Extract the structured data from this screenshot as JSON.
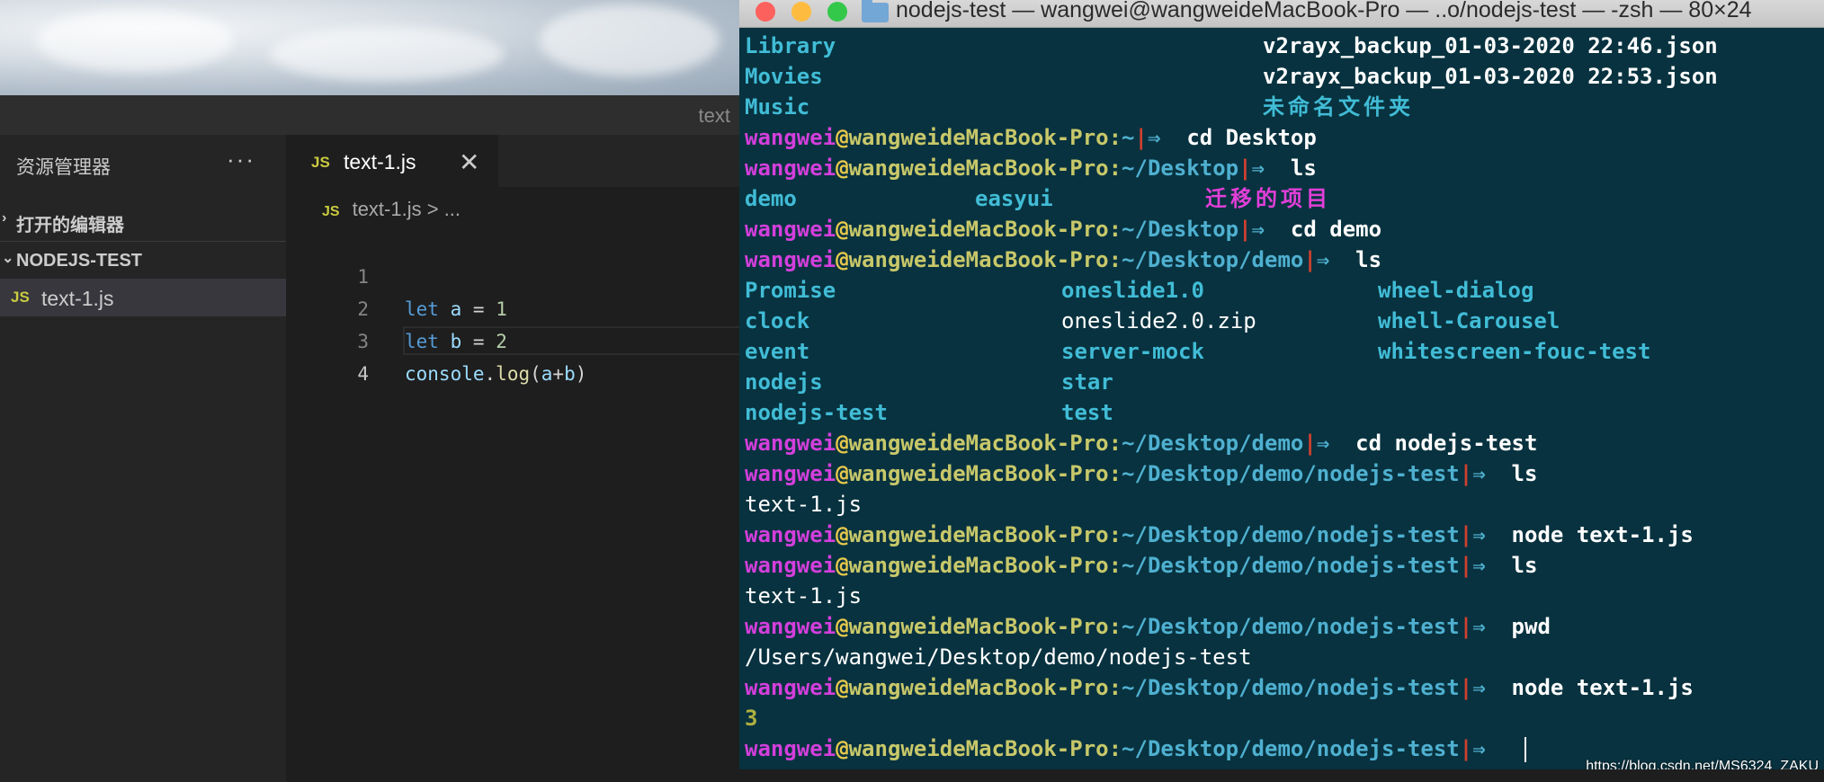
{
  "vscode": {
    "window_title": "text",
    "explorer": {
      "title": "资源管理器",
      "more": "···",
      "open_editors": "打开的编辑器",
      "project": "NODEJS-TEST",
      "file_icon": "JS",
      "file": "text-1.js"
    },
    "tab": {
      "icon": "JS",
      "name": "text-1.js",
      "close": "✕"
    },
    "breadcrumb": {
      "icon": "JS",
      "file": "text-1.js",
      "rest": "> ..."
    },
    "code": {
      "numbers": [
        "1",
        "2",
        "3",
        "4"
      ],
      "line1": {
        "kw": "let",
        "var": "a",
        "op": " = ",
        "num": "1"
      },
      "line2": {
        "kw": "let",
        "var": "b",
        "op": " = ",
        "num": "2"
      },
      "line3": {
        "obj": "console",
        "dot": ".",
        "fn": "log",
        "open": "(",
        "a": "a",
        "plus": "+",
        "b": "b",
        "close": ")"
      }
    }
  },
  "terminal": {
    "title": "nodejs-test — wangwei@wangweideMacBook-Pro — ..o/nodejs-test — -zsh — 80×24",
    "prompt": {
      "user": "wangwei",
      "at": "@",
      "host": "wangweideMacBook-Pro",
      "colon": ":",
      "bar": "|",
      "arrow": "⇒"
    },
    "listing1": [
      [
        "Library",
        "v2rayx_backup_01-03-2020 22:46.json"
      ],
      [
        "Movies",
        "v2rayx_backup_01-03-2020 22:53.json"
      ],
      [
        "Music",
        "未命名文件夹"
      ]
    ],
    "p1": {
      "path": "~",
      "cmd": "cd Desktop"
    },
    "p2": {
      "path": "~/Desktop",
      "cmd": "ls"
    },
    "desktop_ls": [
      "demo",
      "easyui",
      "迁移的项目"
    ],
    "p3": {
      "path": "~/Desktop",
      "cmd": "cd demo"
    },
    "p4": {
      "path": "~/Desktop/demo",
      "cmd": "ls"
    },
    "demo_ls": [
      [
        "Promise",
        "oneslide1.0",
        "wheel-dialog"
      ],
      [
        "clock",
        "oneslide2.0.zip",
        "whell-Carousel"
      ],
      [
        "event",
        "server-mock",
        "whitescreen-fouc-test"
      ],
      [
        "nodejs",
        "star",
        ""
      ],
      [
        "nodejs-test",
        "test",
        ""
      ]
    ],
    "p5": {
      "path": "~/Desktop/demo",
      "cmd": "cd nodejs-test"
    },
    "p6": {
      "path": "~/Desktop/demo/nodejs-test",
      "cmd": "ls"
    },
    "out6": "text-1.js",
    "p7": {
      "path": "~/Desktop/demo/nodejs-test",
      "cmd": "node text-1.js"
    },
    "p8": {
      "path": "~/Desktop/demo/nodejs-test",
      "cmd": "ls"
    },
    "out8": "text-1.js",
    "p9": {
      "path": "~/Desktop/demo/nodejs-test",
      "cmd": "pwd"
    },
    "out9": "/Users/wangwei/Desktop/demo/nodejs-test",
    "p10": {
      "path": "~/Desktop/demo/nodejs-test",
      "cmd": "node text-1.js"
    },
    "out10": "3",
    "p11": {
      "path": "~/Desktop/demo/nodejs-test",
      "cmd": ""
    },
    "watermark": "https://blog.csdn.net/MS6324_ZAKU"
  }
}
